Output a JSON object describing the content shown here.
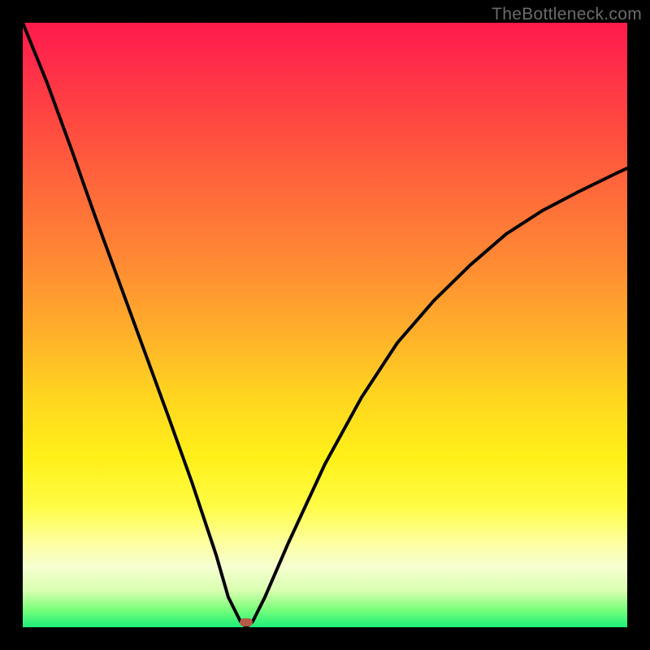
{
  "watermark": "TheBottleneck.com",
  "chart_data": {
    "type": "line",
    "title": "",
    "xlabel": "",
    "ylabel": "",
    "xlim": [
      0,
      100
    ],
    "ylim": [
      0,
      100
    ],
    "gradient_stops": [
      {
        "pos": 0,
        "color": "#ff1a4c"
      },
      {
        "pos": 16,
        "color": "#ff4741"
      },
      {
        "pos": 40,
        "color": "#ff8b33"
      },
      {
        "pos": 62,
        "color": "#ffd61f"
      },
      {
        "pos": 80,
        "color": "#fffc45"
      },
      {
        "pos": 94,
        "color": "#d8ffb0"
      },
      {
        "pos": 100,
        "color": "#1cef77"
      }
    ],
    "series": [
      {
        "name": "bottleneck-curve",
        "x": [
          0,
          4,
          8,
          12,
          16,
          20,
          24,
          28,
          32,
          34,
          36,
          37,
          38,
          40,
          44,
          50,
          56,
          62,
          68,
          74,
          80,
          86,
          92,
          98,
          100
        ],
        "values": [
          100,
          90,
          79,
          68,
          57,
          46,
          35,
          24,
          12,
          5,
          1,
          0,
          1,
          5,
          14,
          27,
          38,
          47,
          54,
          60,
          65,
          69,
          72,
          75,
          76
        ]
      }
    ],
    "marker": {
      "x": 37,
      "y": 0,
      "color": "#b85a4a"
    }
  }
}
